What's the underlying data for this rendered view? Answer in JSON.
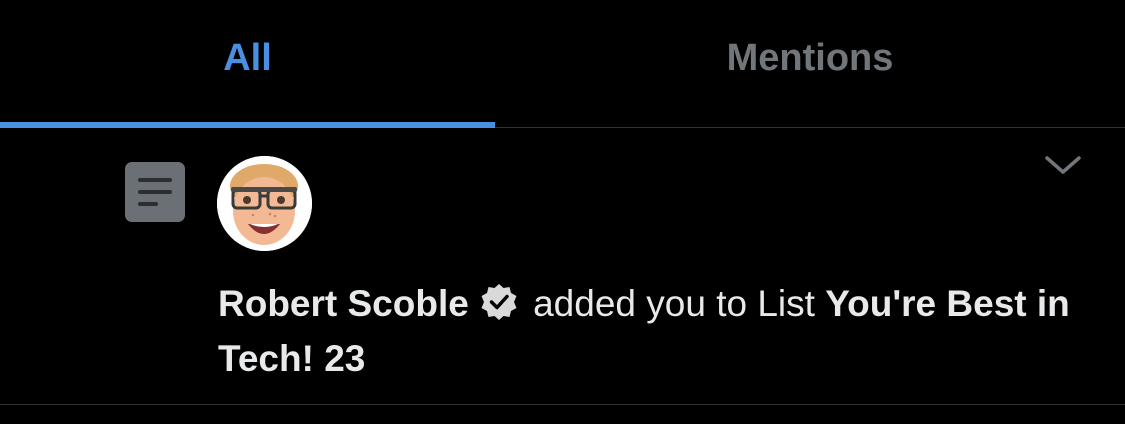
{
  "tabs": [
    {
      "label": "All",
      "active": true
    },
    {
      "label": "Mentions",
      "active": false
    }
  ],
  "colors": {
    "background": "#000000",
    "active_tab": "#4a90e2",
    "inactive_tab": "#71767b",
    "text": "#e7e9ea",
    "divider": "#2f3336"
  },
  "notification": {
    "type_icon": "list-icon",
    "avatar_icon": "memoji-avatar",
    "user_name": "Robert Scoble",
    "verified_icon": "verified-badge-icon",
    "action_text": " added you to List ",
    "list_name": "You're Best in Tech! 23",
    "menu_icon": "chevron-down-icon"
  }
}
